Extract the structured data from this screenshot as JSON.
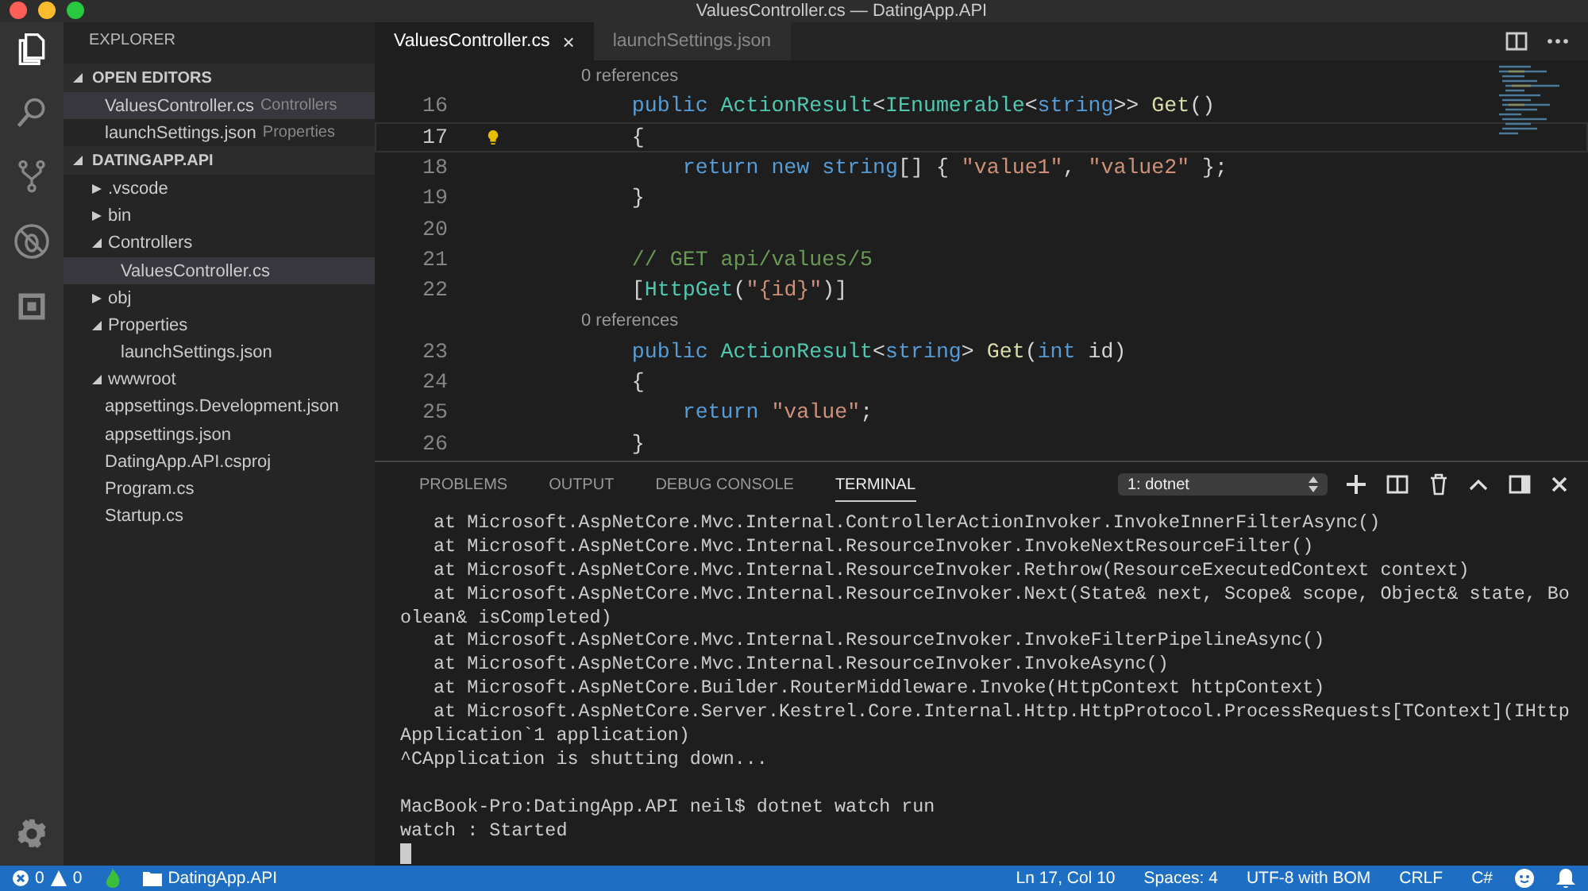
{
  "window": {
    "title": "ValuesController.cs — DatingApp.API"
  },
  "sidebar": {
    "title": "EXPLORER",
    "sections": [
      {
        "title": "OPEN EDITORS",
        "expanded": true,
        "items": [
          {
            "label": "ValuesController.cs",
            "detail": "Controllers",
            "selected": true
          },
          {
            "label": "launchSettings.json",
            "detail": "Properties",
            "selected": false
          }
        ]
      },
      {
        "title": "DATINGAPP.API",
        "expanded": true,
        "tree": [
          {
            "label": ".vscode",
            "folder": true,
            "expanded": false,
            "selected": false
          },
          {
            "label": "bin",
            "folder": true,
            "expanded": false,
            "selected": false
          },
          {
            "label": "Controllers",
            "folder": true,
            "expanded": true,
            "selected": false,
            "children": [
              {
                "label": "ValuesController.cs",
                "folder": false,
                "selected": true
              }
            ]
          },
          {
            "label": "obj",
            "folder": true,
            "expanded": false,
            "selected": false
          },
          {
            "label": "Properties",
            "folder": true,
            "expanded": true,
            "selected": false,
            "children": [
              {
                "label": "launchSettings.json",
                "folder": false,
                "selected": false
              }
            ]
          },
          {
            "label": "wwwroot",
            "folder": true,
            "expanded": true,
            "selected": false
          },
          {
            "label": "appsettings.Development.json",
            "folder": false,
            "selected": false
          },
          {
            "label": "appsettings.json",
            "folder": false,
            "selected": false
          },
          {
            "label": "DatingApp.API.csproj",
            "folder": false,
            "selected": false
          },
          {
            "label": "Program.cs",
            "folder": false,
            "selected": false
          },
          {
            "label": "Startup.cs",
            "folder": false,
            "selected": false
          }
        ]
      }
    ]
  },
  "tabs": [
    {
      "label": "ValuesController.cs",
      "selected": true,
      "close": "×"
    },
    {
      "label": "launchSettings.json",
      "selected": false
    }
  ],
  "editor": {
    "lines": [
      {
        "kind": "lens",
        "text": "0 references"
      },
      {
        "kind": "code",
        "number": "16",
        "active": false,
        "tokens": [
          {
            "text": "    public ",
            "kind": "kw"
          },
          {
            "text": "ActionResult",
            "kind": "type"
          },
          {
            "text": "<",
            "kind": "plain"
          },
          {
            "text": "IEnumerable",
            "kind": "type"
          },
          {
            "text": "<",
            "kind": "plain"
          },
          {
            "text": "string",
            "kind": "kw"
          },
          {
            "text": ">> ",
            "kind": "plain"
          },
          {
            "text": "Get",
            "kind": "fn"
          },
          {
            "text": "()",
            "kind": "plain"
          }
        ]
      },
      {
        "kind": "code",
        "number": "17",
        "active": true,
        "tokens": [
          {
            "text": "    {",
            "kind": "plain"
          }
        ]
      },
      {
        "kind": "code",
        "number": "18",
        "active": false,
        "tokens": [
          {
            "text": "        return ",
            "kind": "kw"
          },
          {
            "text": "new ",
            "kind": "kw"
          },
          {
            "text": "string",
            "kind": "kw"
          },
          {
            "text": "[] { ",
            "kind": "plain"
          },
          {
            "text": "\"value1\"",
            "kind": "str"
          },
          {
            "text": ", ",
            "kind": "plain"
          },
          {
            "text": "\"value2\"",
            "kind": "str"
          },
          {
            "text": " };",
            "kind": "plain"
          }
        ]
      },
      {
        "kind": "code",
        "number": "19",
        "active": false,
        "tokens": [
          {
            "text": "    }",
            "kind": "plain"
          }
        ]
      },
      {
        "kind": "code",
        "number": "20",
        "active": false
      },
      {
        "kind": "code",
        "number": "21",
        "active": false,
        "tokens": [
          {
            "text": "    // GET api/values/5",
            "kind": "comment"
          }
        ]
      },
      {
        "kind": "code",
        "number": "22",
        "active": false,
        "tokens": [
          {
            "text": "    [",
            "kind": "plain"
          },
          {
            "text": "HttpGet",
            "kind": "type"
          },
          {
            "text": "(",
            "kind": "plain"
          },
          {
            "text": "\"{id}\"",
            "kind": "str"
          },
          {
            "text": ")]",
            "kind": "plain"
          }
        ]
      },
      {
        "kind": "lens",
        "text": "0 references"
      },
      {
        "kind": "code",
        "number": "23",
        "active": false,
        "tokens": [
          {
            "text": "    public ",
            "kind": "kw"
          },
          {
            "text": "ActionResult",
            "kind": "type"
          },
          {
            "text": "<",
            "kind": "plain"
          },
          {
            "text": "string",
            "kind": "kw"
          },
          {
            "text": "> ",
            "kind": "plain"
          },
          {
            "text": "Get",
            "kind": "fn"
          },
          {
            "text": "(",
            "kind": "plain"
          },
          {
            "text": "int ",
            "kind": "kw"
          },
          {
            "text": "id)",
            "kind": "plain"
          }
        ]
      },
      {
        "kind": "code",
        "number": "24",
        "active": false,
        "tokens": [
          {
            "text": "    {",
            "kind": "plain"
          }
        ]
      },
      {
        "kind": "code",
        "number": "25",
        "active": false,
        "tokens": [
          {
            "text": "        return ",
            "kind": "kw"
          },
          {
            "text": "\"value\"",
            "kind": "str"
          },
          {
            "text": ";",
            "kind": "plain"
          }
        ]
      },
      {
        "kind": "code",
        "number": "26",
        "active": false,
        "tokens": [
          {
            "text": "    }",
            "kind": "plain"
          }
        ]
      }
    ]
  },
  "panel": {
    "tabs": [
      {
        "label": "PROBLEMS",
        "selected": false
      },
      {
        "label": "OUTPUT",
        "selected": false
      },
      {
        "label": "DEBUG CONSOLE",
        "selected": false
      },
      {
        "label": "TERMINAL",
        "selected": true
      }
    ],
    "terminal_select": "1: dotnet",
    "terminal_lines": [
      "   at Microsoft.AspNetCore.Mvc.Internal.ControllerActionInvoker.InvokeInnerFilterAsync()",
      "   at Microsoft.AspNetCore.Mvc.Internal.ResourceInvoker.InvokeNextResourceFilter()",
      "   at Microsoft.AspNetCore.Mvc.Internal.ResourceInvoker.Rethrow(ResourceExecutedContext context)",
      "   at Microsoft.AspNetCore.Mvc.Internal.ResourceInvoker.Next(State& next, Scope& scope, Object& state, Bo",
      "olean& isCompleted)",
      "   at Microsoft.AspNetCore.Mvc.Internal.ResourceInvoker.InvokeFilterPipelineAsync()",
      "   at Microsoft.AspNetCore.Mvc.Internal.ResourceInvoker.InvokeAsync()",
      "   at Microsoft.AspNetCore.Builder.RouterMiddleware.Invoke(HttpContext httpContext)",
      "   at Microsoft.AspNetCore.Server.Kestrel.Core.Internal.Http.HttpProtocol.ProcessRequests[TContext](IHttp",
      "Application`1 application)",
      "^CApplication is shutting down..."
    ],
    "terminal_session": [
      "MacBook-Pro:DatingApp.API neil$ dotnet watch run",
      "watch : Started"
    ]
  },
  "status_bar": {
    "errors": "0",
    "warnings": "0",
    "folder": "DatingApp.API",
    "position": "Ln 17, Col 10",
    "spaces": "Spaces: 4",
    "encoding": "UTF-8 with BOM",
    "eol": "CRLF",
    "language": "C#"
  }
}
